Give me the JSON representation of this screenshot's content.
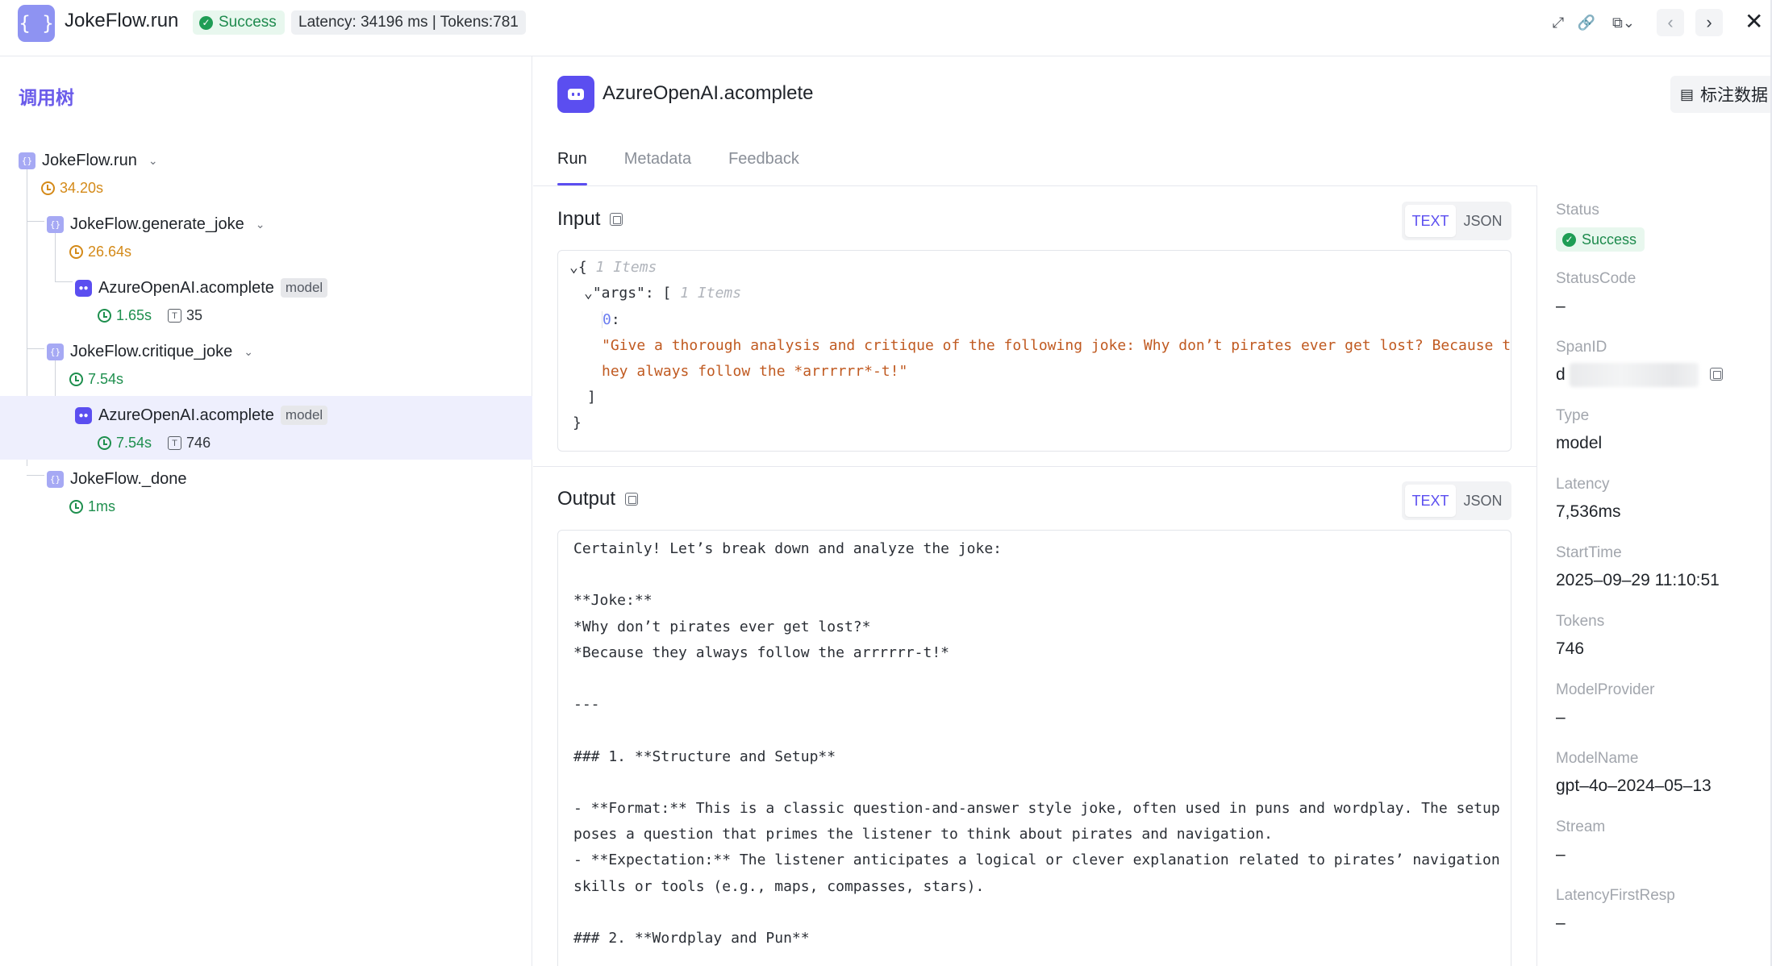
{
  "header": {
    "app_title": "JokeFlow.run",
    "status": "Success",
    "metrics": "Latency: 34196 ms | Tokens:781",
    "logo_glyph": "{ }",
    "icons": [
      "expand-icon",
      "link-icon",
      "copy-dropdown-icon",
      "prev-icon",
      "next-icon",
      "close-icon"
    ]
  },
  "left": {
    "title": "调用树",
    "tree": [
      {
        "name": "JokeFlow.run",
        "time": "34.20s"
      },
      {
        "name": "JokeFlow.generate_joke",
        "time": "26.64s"
      },
      {
        "name": "AzureOpenAI.acomplete",
        "tag": "model",
        "time": "1.65s",
        "tokens": "35"
      },
      {
        "name": "JokeFlow.critique_joke",
        "time": "7.54s"
      },
      {
        "name": "AzureOpenAI.acomplete",
        "tag": "model",
        "time": "7.54s",
        "tokens": "746"
      },
      {
        "name": "JokeFlow._done",
        "time": "1ms"
      }
    ]
  },
  "center": {
    "span_title": "AzureOpenAI.acomplete",
    "annotate_label": "标注数据",
    "tabs": [
      "Run",
      "Metadata",
      "Feedback"
    ],
    "input": {
      "title": "Input",
      "format_options": [
        "TEXT",
        "JSON"
      ],
      "items_hint_root": "1 Items",
      "args_key": "\"args\"",
      "items_hint_args": "1 Items",
      "index": "0",
      "value_line1": "\"Give a thorough analysis and critique of the following joke: Why don’t pirates ever get lost? Because t",
      "value_line2": "hey always follow the *arrrrrr*-t!\""
    },
    "output": {
      "title": "Output",
      "format_options": [
        "TEXT",
        "JSON"
      ],
      "lines": [
        "Certainly! Let’s break down and analyze the joke:",
        "",
        "**Joke:**",
        "*Why don’t pirates ever get lost?*",
        "*Because they always follow the arrrrrr-t!*",
        "",
        "---",
        "",
        "### 1. **Structure and Setup**",
        "",
        "- **Format:** This is a classic question-and-answer style joke, often used in puns and wordplay. The setup",
        "poses a question that primes the listener to think about pirates and navigation.",
        "- **Expectation:** The listener anticipates a logical or clever explanation related to pirates’ navigation",
        "skills or tools (e.g., maps, compasses, stars).",
        "",
        "### 2. **Wordplay and Pun**"
      ]
    }
  },
  "attributes": [
    {
      "label": "Status",
      "value": "Success"
    },
    {
      "label": "StatusCode",
      "value": "–"
    },
    {
      "label": "SpanID",
      "value": "d"
    },
    {
      "label": "Type",
      "value": "model"
    },
    {
      "label": "Latency",
      "value": "7,536ms"
    },
    {
      "label": "StartTime",
      "value": "2025–09–29 11:10:51"
    },
    {
      "label": "Tokens",
      "value": "746"
    },
    {
      "label": "ModelProvider",
      "value": "–"
    },
    {
      "label": "ModelName",
      "value": "gpt–4o–2024–05–13"
    },
    {
      "label": "Stream",
      "value": "–"
    },
    {
      "label": "LatencyFirstResp",
      "value": "–"
    }
  ]
}
